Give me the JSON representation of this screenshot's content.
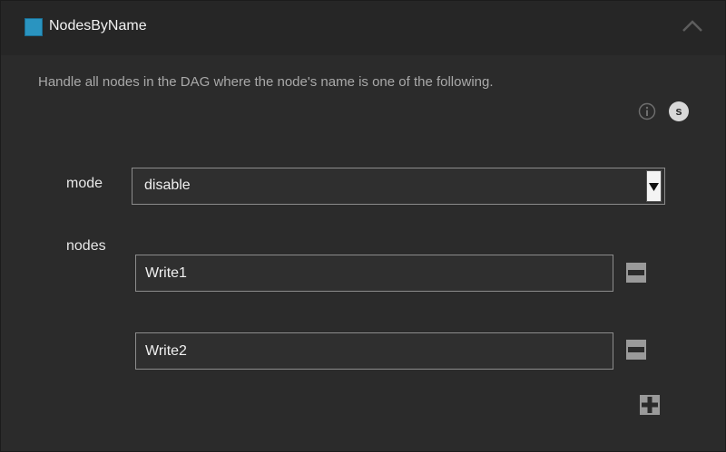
{
  "header": {
    "title": "NodesByName",
    "swatch_color": "#2a94c0",
    "collapse_icon": "chevron-up-icon"
  },
  "description": "Handle all nodes in the DAG where the node's name is one of the following.",
  "badges": {
    "info_icon": "info-icon",
    "s_label": "s"
  },
  "form": {
    "mode": {
      "label": "mode",
      "value": "disable"
    },
    "nodes": {
      "label": "nodes",
      "items": [
        {
          "value": "Write1"
        },
        {
          "value": "Write2"
        }
      ]
    }
  }
}
